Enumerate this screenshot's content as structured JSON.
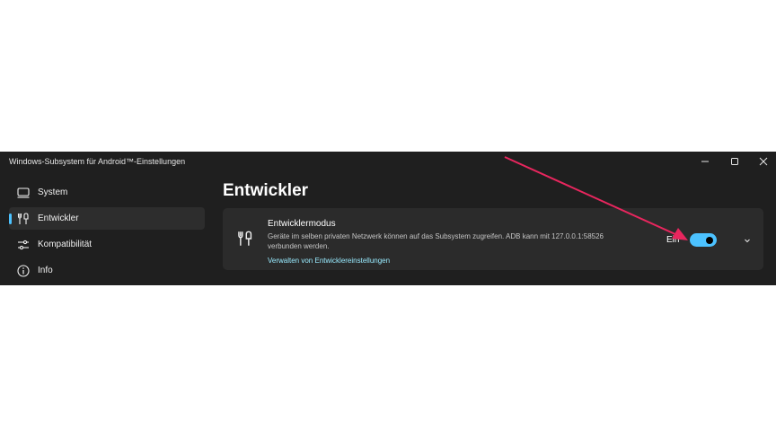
{
  "window": {
    "title": "Windows-Subsystem für Android™-Einstellungen"
  },
  "sidebar": {
    "items": [
      {
        "label": "System",
        "icon": "laptop-icon",
        "active": false
      },
      {
        "label": "Entwickler",
        "icon": "developer-tools-icon",
        "active": true
      },
      {
        "label": "Kompatibilität",
        "icon": "sliders-icon",
        "active": false
      },
      {
        "label": "Info",
        "icon": "info-icon",
        "active": false
      }
    ]
  },
  "main": {
    "page_title": "Entwickler",
    "card": {
      "heading": "Entwicklermodus",
      "description": "Geräte im selben privaten Netzwerk können auf das Subsystem zugreifen. ADB kann mit 127.0.0.1:58526 verbunden werden.",
      "link": "Verwalten von Entwicklereinstellungen",
      "toggle_state_label": "Ein",
      "toggle_on": true
    }
  },
  "colors": {
    "window_bg": "#1f1f1f",
    "card_bg": "#2b2b2b",
    "accent": "#4cc2ff",
    "link": "#99ebff",
    "annotation_arrow": "#e8265e"
  }
}
